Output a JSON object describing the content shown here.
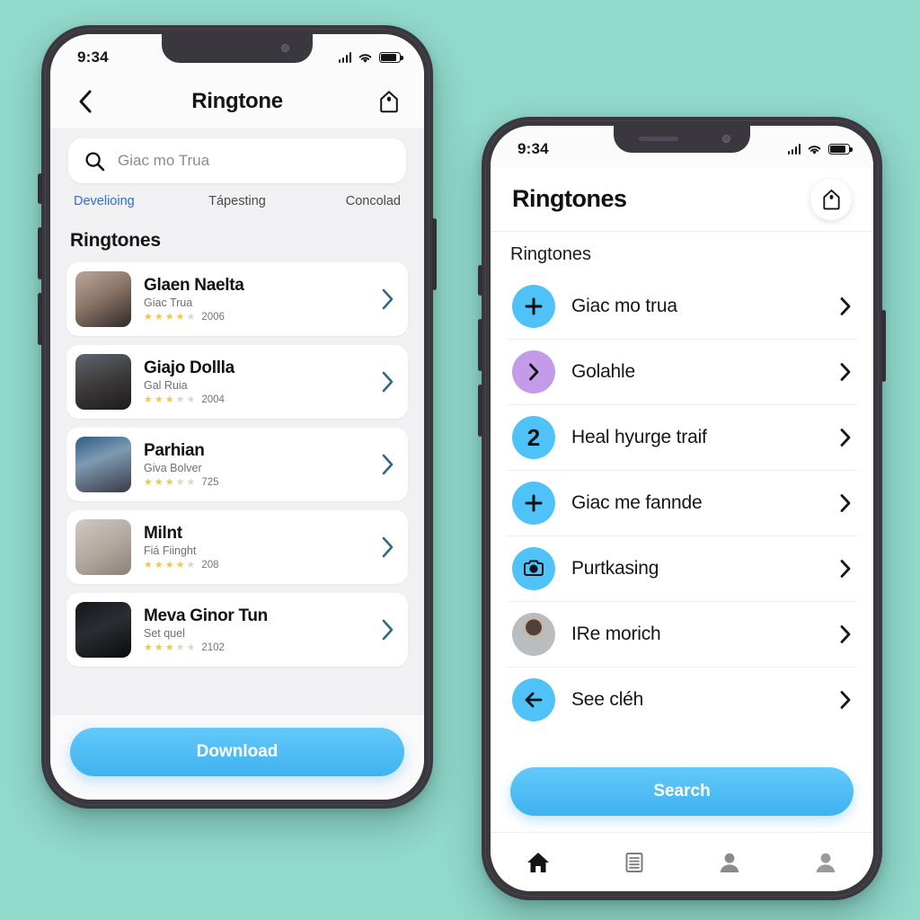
{
  "theme": {
    "background": "#91d9cb",
    "frame": "#3b373f",
    "accent_blue": "#4FBDF5",
    "accent_purple": "#C49BE8",
    "tab_active_blue": "#2f6fd0",
    "star_yellow": "#f3c93a"
  },
  "left_phone": {
    "status": {
      "time": "9:34",
      "signal_icon": "cellular-bars-icon",
      "wifi_icon": "wifi-icon",
      "battery_icon": "battery-icon"
    },
    "nav": {
      "back_icon": "back-chevron-icon",
      "title": "Ringtone",
      "tag_icon": "tag-icon"
    },
    "search": {
      "icon": "search-icon",
      "placeholder": "Giac mo Trua",
      "value": ""
    },
    "tabs": [
      {
        "label": "Develioing",
        "active": true
      },
      {
        "label": "Tápesting",
        "active": false
      },
      {
        "label": "Concolad",
        "active": false
      }
    ],
    "section_title": "Ringtones",
    "items": [
      {
        "title": "Glaen Naelta",
        "subtitle": "Giac Trua",
        "stars": 4,
        "count": "2006",
        "thumb_name": "thumbnail-woman-blonde"
      },
      {
        "title": "Giajo Dollla",
        "subtitle": "Gal Ruia",
        "stars": 3,
        "count": "2004",
        "thumb_name": "thumbnail-woman-dark-hair"
      },
      {
        "title": "Parhian",
        "subtitle": "Giva Bolver",
        "stars": 3,
        "count": "725",
        "thumb_name": "thumbnail-couple-outdoors"
      },
      {
        "title": "Milnt",
        "subtitle": "Fiá Fiinght",
        "stars": 4,
        "count": "208",
        "thumb_name": "thumbnail-woman-white-jacket"
      },
      {
        "title": "Meva Ginor Tun",
        "subtitle": "Set quel",
        "stars": 3,
        "count": "2102",
        "thumb_name": "thumbnail-man-suit"
      }
    ],
    "cta": {
      "label": "Download"
    }
  },
  "right_phone": {
    "status": {
      "time": "9:34",
      "signal_icon": "cellular-bars-icon",
      "wifi_icon": "wifi-icon",
      "battery_icon": "battery-icon"
    },
    "nav": {
      "title": "Ringtones",
      "tag_icon": "tag-icon"
    },
    "subhead": "Ringtones",
    "items": [
      {
        "label": "Giac mo trua",
        "icon": "plus-icon",
        "icon_glyph": "+",
        "circle_color": "#4FC3F7",
        "kind": "glyph"
      },
      {
        "label": "Golahle",
        "icon": "chevron-right-icon",
        "icon_glyph": "›",
        "circle_color": "#C49BE8",
        "kind": "glyph"
      },
      {
        "label": "Heal hyurge traif",
        "icon": "number-two-icon",
        "icon_glyph": "2",
        "circle_color": "#4FC3F7",
        "kind": "glyph"
      },
      {
        "label": "Giac me fannde",
        "icon": "plus-icon",
        "icon_glyph": "+",
        "circle_color": "#4FC3F7",
        "kind": "glyph"
      },
      {
        "label": "Purtkasing",
        "icon": "camera-icon",
        "icon_glyph": "",
        "circle_color": "#4FC3F7",
        "kind": "camera"
      },
      {
        "label": "IRe morich",
        "icon": "avatar-photo",
        "icon_glyph": "",
        "circle_color": "#b9bdc0",
        "kind": "avatar"
      },
      {
        "label": "See cléh",
        "icon": "arrow-left-icon",
        "icon_glyph": "←",
        "circle_color": "#4FC3F7",
        "kind": "glyph"
      }
    ],
    "cta": {
      "label": "Search"
    },
    "tabbar": [
      {
        "icon": "home-icon",
        "active": true
      },
      {
        "icon": "list-icon",
        "active": false
      },
      {
        "icon": "person-icon",
        "active": false
      },
      {
        "icon": "person-alt-icon",
        "active": false
      }
    ]
  }
}
